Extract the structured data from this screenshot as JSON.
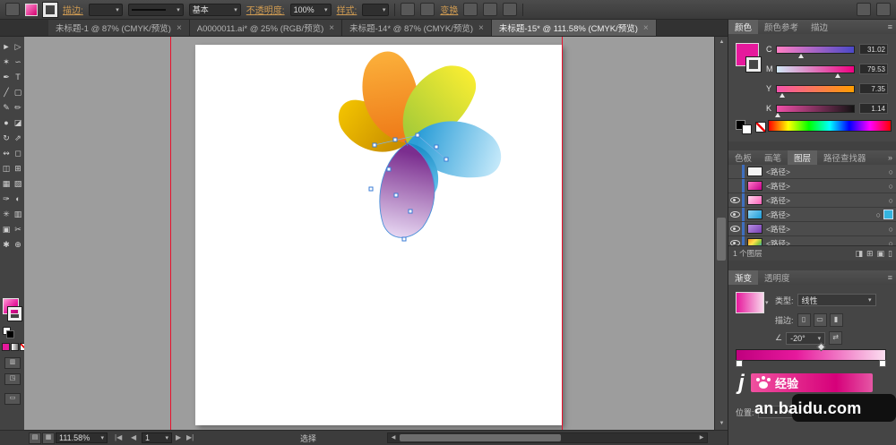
{
  "top_bar": {
    "stroke_label": "描边:",
    "brush_value": "基本",
    "opacity_label": "不透明度:",
    "opacity_value": "100%",
    "style_label": "样式:",
    "transform_label": "变换"
  },
  "tabs": [
    {
      "label": "未标题-1 @ 87% (CMYK/预览)",
      "active": false
    },
    {
      "label": "A0000011.ai* @ 25% (RGB/预览)",
      "active": false
    },
    {
      "label": "未标题-14* @ 87% (CMYK/预览)",
      "active": false
    },
    {
      "label": "未标题-15* @ 111.58% (CMYK/预览)",
      "active": true
    }
  ],
  "toolbar": {
    "tools": [
      {
        "name": "selection-tool",
        "glyph": "►"
      },
      {
        "name": "direct-selection-tool",
        "glyph": "▷"
      },
      {
        "name": "magic-wand-tool",
        "glyph": "✶"
      },
      {
        "name": "lasso-tool",
        "glyph": "∽"
      },
      {
        "name": "pen-tool",
        "glyph": "✒"
      },
      {
        "name": "type-tool",
        "glyph": "T"
      },
      {
        "name": "line-segment-tool",
        "glyph": "╱"
      },
      {
        "name": "rectangle-tool",
        "glyph": "▢"
      },
      {
        "name": "paintbrush-tool",
        "glyph": "✎"
      },
      {
        "name": "pencil-tool",
        "glyph": "✏"
      },
      {
        "name": "blob-brush-tool",
        "glyph": "●"
      },
      {
        "name": "eraser-tool",
        "glyph": "◪"
      },
      {
        "name": "rotate-tool",
        "glyph": "↻"
      },
      {
        "name": "scale-tool",
        "glyph": "⇗"
      },
      {
        "name": "width-tool",
        "glyph": "↭"
      },
      {
        "name": "free-transform-tool",
        "glyph": "◻"
      },
      {
        "name": "shape-builder-tool",
        "glyph": "◫"
      },
      {
        "name": "perspective-grid-tool",
        "glyph": "⊞"
      },
      {
        "name": "mesh-tool",
        "glyph": "▦"
      },
      {
        "name": "gradient-tool",
        "glyph": "▧"
      },
      {
        "name": "eyedropper-tool",
        "glyph": "✑"
      },
      {
        "name": "blend-tool",
        "glyph": "◐"
      },
      {
        "name": "symbol-sprayer-tool",
        "glyph": "✳"
      },
      {
        "name": "column-graph-tool",
        "glyph": "▥"
      },
      {
        "name": "artboard-tool",
        "glyph": "▣"
      },
      {
        "name": "slice-tool",
        "glyph": "✂"
      },
      {
        "name": "hand-tool",
        "glyph": "✱"
      },
      {
        "name": "zoom-tool",
        "glyph": "⊕"
      }
    ]
  },
  "color_panel": {
    "tabs": [
      {
        "label": "颜色",
        "name": "tab-color",
        "active": true
      },
      {
        "label": "颜色参考",
        "name": "tab-color-guide",
        "active": false
      },
      {
        "label": "描边",
        "name": "tab-stroke",
        "active": false
      }
    ],
    "channels": [
      {
        "label": "C",
        "value": "31.02",
        "percent": 31
      },
      {
        "label": "M",
        "value": "79.53",
        "percent": 79
      },
      {
        "label": "Y",
        "value": "7.35",
        "percent": 7
      },
      {
        "label": "K",
        "value": "1.14",
        "percent": 1
      }
    ],
    "fill_color": "#e6199c"
  },
  "dock_tabs": [
    {
      "label": "色板",
      "name": "tab-swatches",
      "active": false
    },
    {
      "label": "画笔",
      "name": "tab-brushes",
      "active": false
    },
    {
      "label": "图层",
      "name": "tab-layers",
      "active": true
    },
    {
      "label": "路径查找器",
      "name": "tab-pathfinder",
      "active": false
    }
  ],
  "layers_panel": {
    "rows": [
      {
        "label": "<路径>",
        "eye": false,
        "thumb": "white",
        "selected": false
      },
      {
        "label": "<路径>",
        "eye": false,
        "thumb": "magenta",
        "selected": false
      },
      {
        "label": "<路径>",
        "eye": true,
        "thumb": "pink",
        "selected": false
      },
      {
        "label": "<路径>",
        "eye": true,
        "thumb": "blue",
        "selected": true
      },
      {
        "label": "<路径>",
        "eye": true,
        "thumb": "purple",
        "selected": false
      },
      {
        "label": "<路径>",
        "eye": true,
        "thumb": "multi",
        "selected": false
      }
    ],
    "status": "1 个图层",
    "buttons": [
      {
        "name": "make-clipping-mask-button",
        "glyph": "◨"
      },
      {
        "name": "new-sublayer-button",
        "glyph": "⊞"
      },
      {
        "name": "new-layer-button",
        "glyph": "▣"
      },
      {
        "name": "delete-layer-button",
        "glyph": "▯"
      }
    ]
  },
  "gradient_panel": {
    "tabs": [
      {
        "label": "渐变",
        "name": "tab-gradient",
        "active": true
      },
      {
        "label": "透明度",
        "name": "tab-transparency",
        "active": false
      }
    ],
    "type_label": "类型:",
    "type_value": "线性",
    "stroke_label": "描边:",
    "stroke_buttons": [
      {
        "name": "gradient-within-stroke-button",
        "glyph": "▯"
      },
      {
        "name": "gradient-along-stroke-button",
        "glyph": "▭"
      },
      {
        "name": "gradient-across-stroke-button",
        "glyph": "▮"
      }
    ],
    "angle_value": "-20°",
    "position_label": "位置:"
  },
  "status_bar": {
    "zoom": "111.58%",
    "artboard": "1",
    "tool_label": "选择"
  },
  "watermark": {
    "prefix": "j",
    "brand": "经验",
    "domain": "an.baidu.com"
  },
  "icons": {
    "close": "×",
    "dropdown": "▾",
    "menu": "≡",
    "target": "○",
    "collapse": "»",
    "left_arrow": "◀",
    "right_arrow": "▶",
    "first": "|◀",
    "last": "▶|",
    "up_arrow": "▲",
    "down_arrow": "▼",
    "angle": "∠",
    "reverse": "⇄"
  },
  "colors": {
    "accent_magenta": "#e6199c",
    "selection_blue": "#4a90d9",
    "guide_red": "#e8112d",
    "petal_orange": "#f7931e",
    "petal_gold": "#e0a800",
    "petal_yellow_green": "#c4d600",
    "petal_blue": "#29abe2",
    "petal_cyan": "#1b9cd8",
    "petal_purple": "#93278f"
  }
}
